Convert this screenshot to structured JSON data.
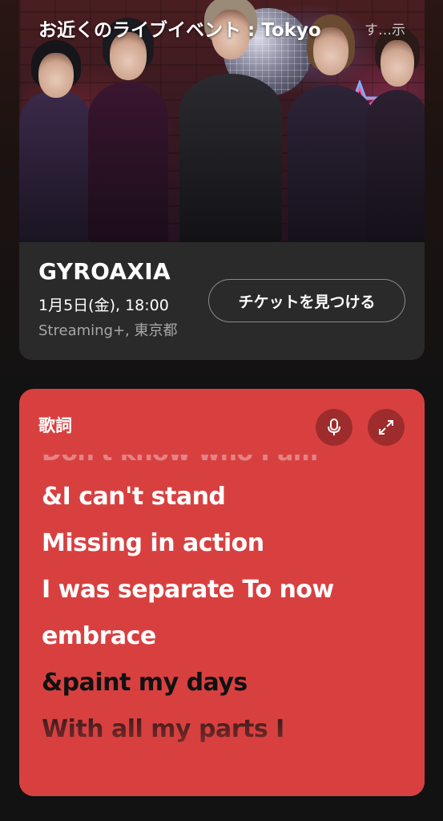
{
  "event": {
    "section_title": "お近くのライブイベント : Tokyo",
    "show_all_label": "す…示",
    "artist": "GYROAXIA",
    "date": "1月5日(金), 18:00",
    "venue": "Streaming+, 東京都",
    "ticket_button_label": "チケットを見つける"
  },
  "lyrics": {
    "header": "歌詞",
    "clipped_line": "Don't know who I am",
    "lines": [
      {
        "text": "&I can't stand",
        "state": "sung"
      },
      {
        "text": "Missing in action",
        "state": "sung"
      },
      {
        "text": "I was separate To now",
        "state": "sung"
      },
      {
        "text": "embrace",
        "state": "sung"
      },
      {
        "text": "&paint my days",
        "state": "upcoming"
      },
      {
        "text": "With all my parts I",
        "state": "upcoming"
      }
    ],
    "card_color": "#d84040",
    "icons": [
      "microphone-icon",
      "expand-icon"
    ]
  }
}
